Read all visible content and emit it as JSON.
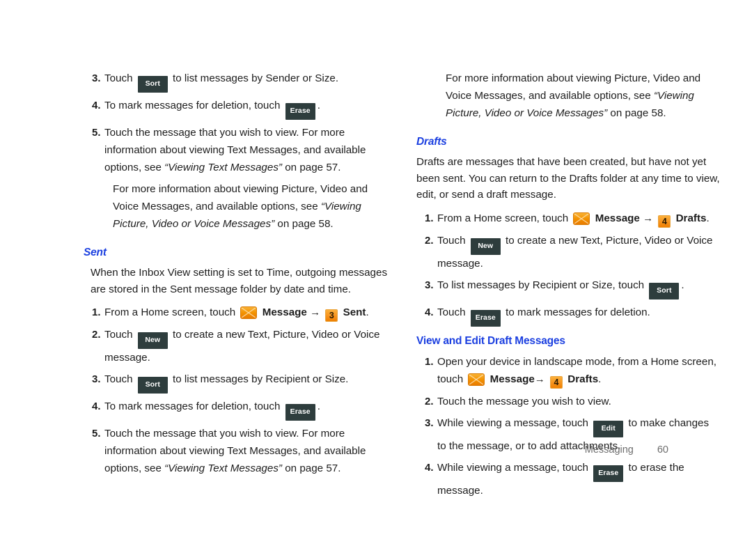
{
  "document": {
    "footer": {
      "section": "Messaging",
      "page_number": "60"
    },
    "accent_blue": "#1b3fe0",
    "key_button_bg": "#2e3d3d",
    "badge_orange": "#f7931e"
  },
  "left_column": {
    "top_steps": [
      {
        "num": "3.",
        "pre": "Touch",
        "key": "Sort",
        "post": "to list messages by Sender or Size."
      },
      {
        "num": "4.",
        "pre": "To mark messages for deletion, touch",
        "key": "Erase",
        "post": "."
      },
      {
        "num": "5.",
        "text_1": "Touch the message that you wish to view. For more",
        "text_2": "information about viewing Text Messages, and available",
        "text_3_pre": "options, see",
        "text_3_italic": "“Viewing Text Messages”",
        "text_3_post": "on page 57."
      }
    ],
    "top_note": {
      "line_1": "For more information about viewing Picture, Video and",
      "line_2_pre": "Voice Messages, and available options, see",
      "line_2_italic": "“Viewing",
      "line_3_italic": "Picture, Video or Voice Messages”",
      "line_3_post": "on page 58."
    },
    "sent_heading": "Sent",
    "sent_intro_line_1": "When the Inbox View setting is set to Time, outgoing  messages",
    "sent_intro_line_2": "are stored in the Sent message folder by date and time.",
    "sent_steps": [
      {
        "num": "1.",
        "pre": "From a Home screen, touch",
        "icon": "envelope-icon",
        "label_1": "Message",
        "arrow": "→",
        "badge": "3",
        "label_2": "Sent",
        "post": "."
      },
      {
        "num": "2.",
        "pre": "Touch",
        "key": "New",
        "post": "to create a new Text, Picture, Video or Voice",
        "cont": "message."
      },
      {
        "num": "3.",
        "pre": "Touch",
        "key": "Sort",
        "post": "to list messages by Recipient or Size."
      },
      {
        "num": "4.",
        "pre": "To mark messages for deletion, touch",
        "key": "Erase",
        "post": "."
      },
      {
        "num": "5.",
        "text_1": "Touch the message that you wish to view. For more",
        "text_2": "information about viewing Text Messages, and available",
        "text_3_pre": "options, see",
        "text_3_italic": "“Viewing Text Messages”",
        "text_3_post": "on page 57."
      }
    ]
  },
  "right_column": {
    "top_note": {
      "line_1": "For more information about viewing Picture, Video and",
      "line_2_pre": "Voice Messages, and available options, see",
      "line_2_italic": "“Viewing",
      "line_3_italic": "Picture, Video or Voice Messages”",
      "line_3_post": "on page 58."
    },
    "drafts_heading": "Drafts",
    "drafts_intro_line_1": "Drafts are messages that have been created, but have not yet",
    "drafts_intro_line_2": "been sent. You can return to the Drafts folder at any time to view,",
    "drafts_intro_line_3": "edit, or send a draft message.",
    "drafts_steps": [
      {
        "num": "1.",
        "pre": "From a Home screen, touch",
        "icon": "envelope-icon",
        "label_1": "Message",
        "arrow": "→",
        "badge": "4",
        "label_2": "Drafts",
        "post": "."
      },
      {
        "num": "2.",
        "pre": "Touch",
        "key": "New",
        "post": "to create a new Text, Picture, Video or Voice",
        "cont": "message."
      },
      {
        "num": "3.",
        "pre": "To list messages by Recipient or Size, touch",
        "key": "Sort",
        "post": "."
      },
      {
        "num": "4.",
        "pre": "Touch",
        "key": "Erase",
        "post": "to mark messages for deletion."
      }
    ],
    "view_edit_heading": "View and Edit Draft Messages",
    "view_edit_steps": [
      {
        "num": "1.",
        "text_1": "Open your device in landscape mode, from a Home screen,",
        "pre_2": "touch",
        "icon": "envelope-icon",
        "label_1": "Message",
        "arrow": "→",
        "badge": "4",
        "label_2": "Drafts",
        "post": "."
      },
      {
        "num": "2.",
        "text_1": "Touch the message you wish to view."
      },
      {
        "num": "3.",
        "pre": "While viewing a message, touch",
        "key": "Edit",
        "post": "to make changes",
        "cont": "to the message, or to add attachments."
      },
      {
        "num": "4.",
        "pre": "While viewing a message, touch",
        "key": "Erase",
        "post": "to erase the",
        "cont": "message."
      }
    ]
  }
}
